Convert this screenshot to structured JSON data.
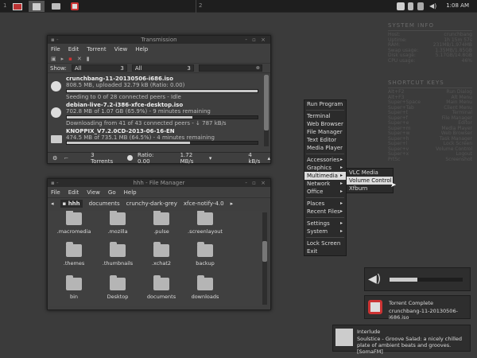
{
  "panel": {
    "workspace1": "1",
    "workspace2": "2",
    "clock": "1:08 AM"
  },
  "transmission": {
    "title": "Transmission",
    "menu": [
      "File",
      "Edit",
      "Torrent",
      "View",
      "Help"
    ],
    "show_label": "Show:",
    "filter1": "All",
    "filter1_count": "3",
    "filter2": "All",
    "filter2_count": "3",
    "torrents": [
      {
        "name": "crunchbang-11-20130506-i686.iso",
        "size": "808.5 MB, uploaded 32.79 kB (Ratio: 0.00)",
        "status": "Seeding to 0 of 28 connected peers - Idle",
        "progress": 1.0
      },
      {
        "name": "debian-live-7.2-i386-xfce-desktop.iso",
        "size": "702.8 MB of 1.07 GB (65.9%) - 9 minutes remaining",
        "status": "Downloading from 41 of 43 connected peers - ↓ 787 kB/s",
        "progress": 0.659
      },
      {
        "name": "KNOPPIX_V7.2.0CD-2013-06-16-EN",
        "size": "474.5 MB of 735.1 MB (64.5%) - 4 minutes remaining",
        "status": "",
        "progress": 0.645
      }
    ],
    "status": {
      "count": "3 Torrents",
      "ratio": "Ratio: 0.00",
      "down": "1.72 MB/s",
      "up": "4 kB/s"
    }
  },
  "filemanager": {
    "title": "hhh - File Manager",
    "menu": [
      "File",
      "Edit",
      "View",
      "Go",
      "Help"
    ],
    "path": [
      "hhh",
      "documents",
      "crunchy-dark-grey",
      "xfce-notify-4.0"
    ],
    "items": [
      ".macromedia",
      ".mozilla",
      ".pulse",
      ".screenlayout",
      ".themes",
      ".thumbnails",
      ".xchat2",
      "backup",
      "bin",
      "Desktop",
      "documents",
      "downloads"
    ]
  },
  "sysinfo": {
    "title": "SYSTEM INFO",
    "rows": [
      [
        "Host:",
        "crunchbang"
      ],
      [
        "Uptime:",
        "1h 15m 57s"
      ],
      [
        "RAM:",
        "231MB/1,974MB"
      ],
      [
        "Swap usage:",
        "1.35MB/1.85GB"
      ],
      [
        "Disk usage:",
        "5.17GB/14.8GB"
      ],
      [
        "CPU usage:",
        "46%"
      ]
    ]
  },
  "shortcuts": {
    "title": "SHORTCUT KEYS",
    "rows": [
      [
        "Alt+F2",
        "Run Dialog"
      ],
      [
        "Alt+F3",
        "Alt Menu"
      ],
      [
        "Super+Space",
        "Main Menu"
      ],
      [
        "Super+Tab",
        "Client Menu"
      ],
      [
        "Super+t",
        "Terminal"
      ],
      [
        "Super+f",
        "File Manager"
      ],
      [
        "Super+e",
        "Editor"
      ],
      [
        "Super+m",
        "Media Player"
      ],
      [
        "Super+w",
        "Web Browser"
      ],
      [
        "Super+h",
        "Task Manager"
      ],
      [
        "Super+l",
        "Lock Screen"
      ],
      [
        "Super+v",
        "Volume Control"
      ],
      [
        "Super+x",
        "Logout"
      ],
      [
        "PrtSc",
        "Screenshot"
      ]
    ]
  },
  "main_menu": [
    {
      "label": "Run Program",
      "arrow": false,
      "sep_after": true
    },
    {
      "label": "Terminal",
      "arrow": false
    },
    {
      "label": "Web Browser",
      "arrow": false
    },
    {
      "label": "File Manager",
      "arrow": false
    },
    {
      "label": "Text Editor",
      "arrow": false
    },
    {
      "label": "Media Player",
      "arrow": false,
      "sep_after": true
    },
    {
      "label": "Accessories",
      "arrow": true
    },
    {
      "label": "Graphics",
      "arrow": true
    },
    {
      "label": "Multimedia",
      "arrow": true,
      "selected": true
    },
    {
      "label": "Network",
      "arrow": true
    },
    {
      "label": "Office",
      "arrow": true,
      "sep_after": true
    },
    {
      "label": "Places",
      "arrow": true
    },
    {
      "label": "Recent Files",
      "arrow": true,
      "sep_after": true
    },
    {
      "label": "Settings",
      "arrow": true
    },
    {
      "label": "System",
      "arrow": true,
      "sep_after": true
    },
    {
      "label": "Lock Screen",
      "arrow": false
    },
    {
      "label": "Exit",
      "arrow": false
    }
  ],
  "submenu": [
    {
      "label": "VLC Media Player"
    },
    {
      "label": "Volume Control",
      "selected": true
    },
    {
      "label": "Xfburn"
    }
  ],
  "notifications": {
    "volume_level": 0.38,
    "torrent_title": "Torrent Complete",
    "torrent_body": "crunchbang-11-20130506-i686.iso",
    "music_title": "Interlude",
    "music_body": "Soulstice - Groove Salad: a nicely chilled plate of ambient beats and grooves. [SomaFM]"
  }
}
